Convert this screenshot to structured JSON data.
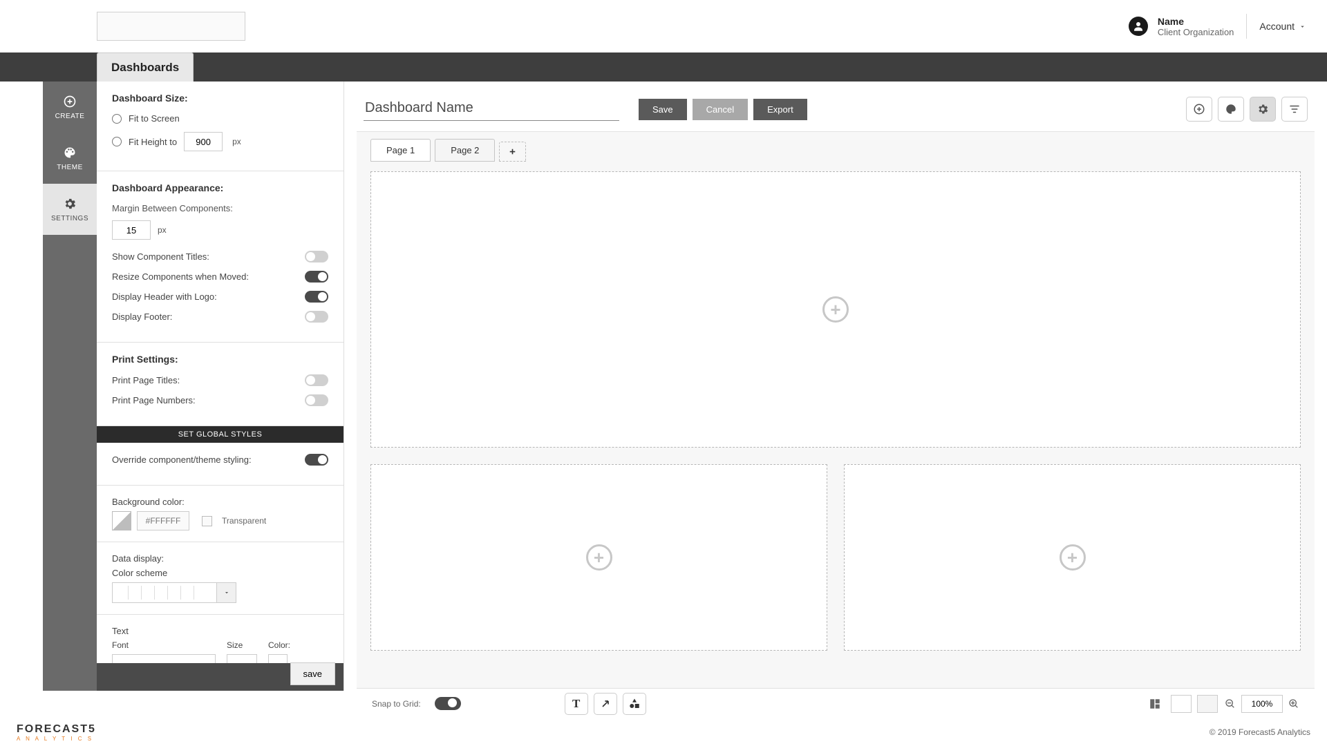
{
  "header": {
    "user_name": "Name",
    "user_org": "Client Organization",
    "account_label": "Account"
  },
  "tabstrip": {
    "dashboards": "Dashboards"
  },
  "rail": {
    "create": "CREATE",
    "theme": "THEME",
    "settings": "SETTINGS"
  },
  "settings": {
    "size_heading": "Dashboard Size:",
    "fit_screen": "Fit to Screen",
    "fit_height": "Fit Height to",
    "fit_height_value": "900",
    "px": "px",
    "appearance_heading": "Dashboard Appearance:",
    "margin_label": "Margin Between Components:",
    "margin_value": "15",
    "show_titles": "Show Component Titles:",
    "resize_moved": "Resize Components when Moved:",
    "display_header_logo": "Display Header with Logo:",
    "display_footer": "Display Footer:",
    "print_heading": "Print Settings:",
    "print_titles": "Print Page Titles:",
    "print_numbers": "Print Page Numbers:",
    "global_bar": "SET GLOBAL STYLES",
    "override": "Override component/theme styling:",
    "bg_label": "Background color:",
    "bg_hex": "#FFFFFF",
    "transparent": "Transparent",
    "data_display": "Data display:",
    "color_scheme": "Color scheme",
    "text_label": "Text",
    "font": "Font",
    "size": "Size",
    "color": "Color:",
    "save": "save"
  },
  "canvas": {
    "dash_name": "Dashboard Name",
    "save": "Save",
    "cancel": "Cancel",
    "export": "Export",
    "page1": "Page 1",
    "page2": "Page 2"
  },
  "bottom": {
    "snap": "Snap to Grid:",
    "zoom": "100%"
  },
  "footer": {
    "brand": "FORECAST5",
    "brand_sub": "A N A L Y T I C S",
    "copyright": "© 2019 Forecast5 Analytics"
  }
}
